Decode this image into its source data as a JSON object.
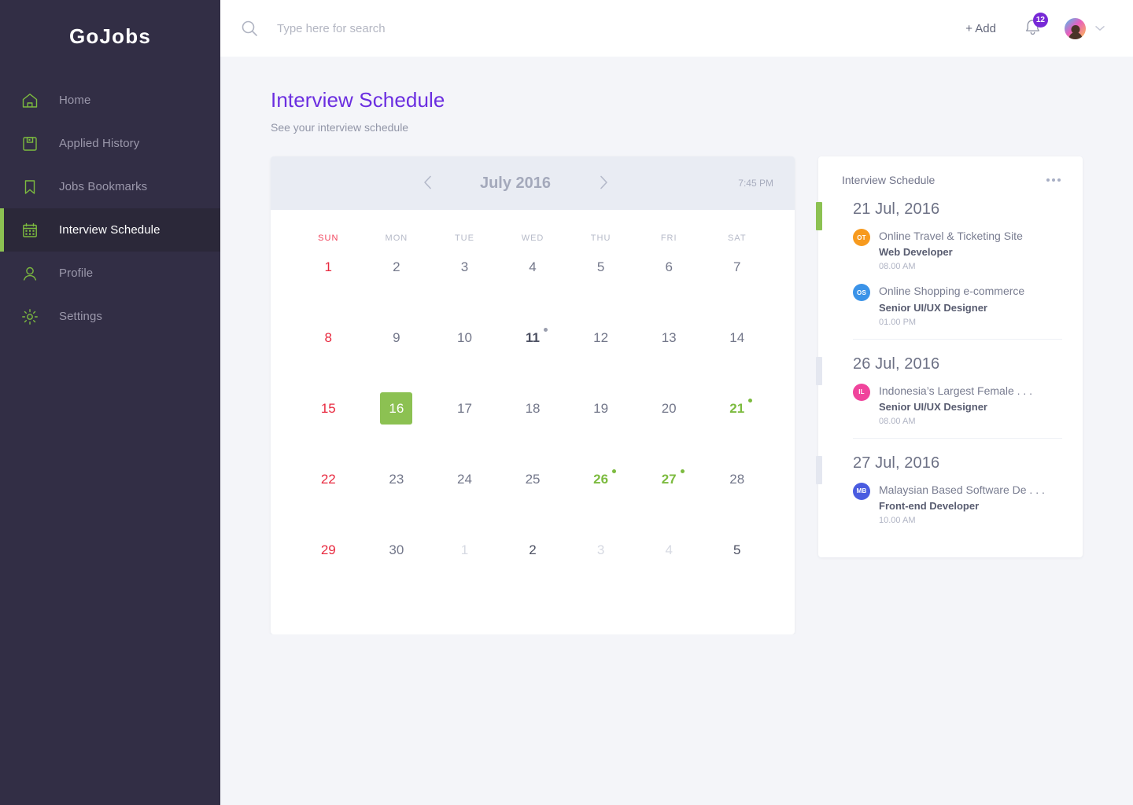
{
  "brand": {
    "name": "GoJobs"
  },
  "sidebar": {
    "items": [
      {
        "label": "Home",
        "icon": "home-icon",
        "active": false
      },
      {
        "label": "Applied History",
        "icon": "document-icon",
        "active": false
      },
      {
        "label": "Jobs Bookmarks",
        "icon": "bookmark-icon",
        "active": false
      },
      {
        "label": "Interview Schedule",
        "icon": "calendar-icon",
        "active": true
      },
      {
        "label": "Profile",
        "icon": "user-icon",
        "active": false
      },
      {
        "label": "Settings",
        "icon": "gear-icon",
        "active": false
      }
    ]
  },
  "topbar": {
    "search_placeholder": "Type here for search",
    "search_value": "",
    "add_label": "+ Add",
    "notification_count": "12",
    "accent_purple": "#7729d6"
  },
  "page": {
    "title": "Interview Schedule",
    "subtitle": "See your interview schedule",
    "title_color": "#6b2ee0"
  },
  "calendar": {
    "month_label": "July 2016",
    "time_label": "7:45 PM",
    "prev_label": "‹",
    "next_label": "›",
    "weekdays": [
      "SUN",
      "MON",
      "TUE",
      "WED",
      "THU",
      "FRI",
      "SAT"
    ],
    "today_color": "#8cc152",
    "sunday_color": "#e8293f",
    "event_color": "#7cbb3f",
    "weeks": [
      [
        {
          "n": "1",
          "style": "sun",
          "dot": ""
        },
        {
          "n": "2",
          "style": "",
          "dot": ""
        },
        {
          "n": "3",
          "style": "",
          "dot": ""
        },
        {
          "n": "4",
          "style": "",
          "dot": ""
        },
        {
          "n": "5",
          "style": "",
          "dot": ""
        },
        {
          "n": "6",
          "style": "",
          "dot": ""
        },
        {
          "n": "7",
          "style": "",
          "dot": ""
        }
      ],
      [
        {
          "n": "8",
          "style": "sun",
          "dot": ""
        },
        {
          "n": "9",
          "style": "",
          "dot": ""
        },
        {
          "n": "10",
          "style": "",
          "dot": ""
        },
        {
          "n": "11",
          "style": "bold",
          "dot": "gray"
        },
        {
          "n": "12",
          "style": "",
          "dot": ""
        },
        {
          "n": "13",
          "style": "",
          "dot": ""
        },
        {
          "n": "14",
          "style": "",
          "dot": ""
        }
      ],
      [
        {
          "n": "15",
          "style": "sun",
          "dot": ""
        },
        {
          "n": "16",
          "style": "today",
          "dot": ""
        },
        {
          "n": "17",
          "style": "",
          "dot": ""
        },
        {
          "n": "18",
          "style": "",
          "dot": ""
        },
        {
          "n": "19",
          "style": "",
          "dot": ""
        },
        {
          "n": "20",
          "style": "",
          "dot": ""
        },
        {
          "n": "21",
          "style": "green",
          "dot": "green"
        }
      ],
      [
        {
          "n": "22",
          "style": "sun",
          "dot": ""
        },
        {
          "n": "23",
          "style": "",
          "dot": ""
        },
        {
          "n": "24",
          "style": "",
          "dot": ""
        },
        {
          "n": "25",
          "style": "",
          "dot": ""
        },
        {
          "n": "26",
          "style": "green",
          "dot": "green"
        },
        {
          "n": "27",
          "style": "green",
          "dot": "green"
        },
        {
          "n": "28",
          "style": "",
          "dot": ""
        }
      ],
      [
        {
          "n": "29",
          "style": "sun",
          "dot": ""
        },
        {
          "n": "30",
          "style": "",
          "dot": ""
        },
        {
          "n": "1",
          "style": "muted",
          "dot": ""
        },
        {
          "n": "2",
          "style": "dark",
          "dot": ""
        },
        {
          "n": "3",
          "style": "muted",
          "dot": ""
        },
        {
          "n": "4",
          "style": "muted",
          "dot": ""
        },
        {
          "n": "5",
          "style": "dark",
          "dot": ""
        }
      ]
    ]
  },
  "schedule_panel": {
    "title": "Interview Schedule",
    "menu_label": "more-options",
    "groups": [
      {
        "date": "21 Jul, 2016",
        "accent": "green",
        "items": [
          {
            "initials": "OT",
            "avatar_color": "#f79a1e",
            "company": "Online Travel & Ticketing Site",
            "role": "Web Developer",
            "time": "08.00 AM"
          },
          {
            "initials": "OS",
            "avatar_color": "#3b93e8",
            "company": "Online Shopping e-commerce",
            "role": "Senior UI/UX Designer",
            "time": "01.00 PM"
          }
        ]
      },
      {
        "date": "26 Jul, 2016",
        "accent": "gray",
        "items": [
          {
            "initials": "IL",
            "avatar_color": "#f0449c",
            "company": "Indonesia’s Largest Female . . .",
            "role": "Senior UI/UX Designer",
            "time": "08.00 AM"
          }
        ]
      },
      {
        "date": "27 Jul, 2016",
        "accent": "gray",
        "items": [
          {
            "initials": "MB",
            "avatar_color": "#4a5ce0",
            "company": "Malaysian Based Software De . . .",
            "role": "Front-end Developer",
            "time": "10.00 AM"
          }
        ]
      }
    ]
  }
}
